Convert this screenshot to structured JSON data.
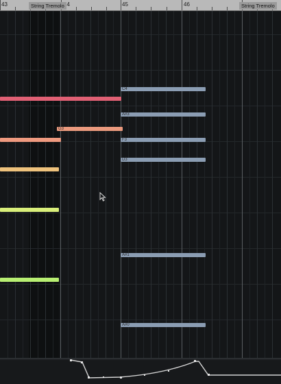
{
  "ruler": {
    "bars": [
      "43",
      "44",
      "45",
      "46"
    ],
    "regions": [
      "String Tremolo",
      "String Tremolo"
    ]
  },
  "notes": [
    {
      "label": "C4",
      "color": "#8b9db3"
    },
    {
      "label": "",
      "color": "#e06074"
    },
    {
      "label": "A#3",
      "color": "#8b9db3"
    },
    {
      "label": "G3",
      "color": "#eb9a7e"
    },
    {
      "label": "F3",
      "color": "#8b9db3"
    },
    {
      "label": "",
      "color": "#ef9a7f"
    },
    {
      "label": "D3",
      "color": "#8b9db3"
    },
    {
      "label": "",
      "color": "#eec27c"
    },
    {
      "label": "",
      "color": "#d9ef7a"
    },
    {
      "label": "A#1",
      "color": "#8b9db3"
    },
    {
      "label": "",
      "color": "#b8ef72"
    },
    {
      "label": "A#0",
      "color": "#8b9db3"
    }
  ],
  "colors": {
    "ruler": "#b9b9b9",
    "grid_bg": "#141618",
    "note_blue": "#8b9db3",
    "automation": "#d4d4d4"
  },
  "icons": {
    "cursor": "pointer-cursor-icon"
  }
}
